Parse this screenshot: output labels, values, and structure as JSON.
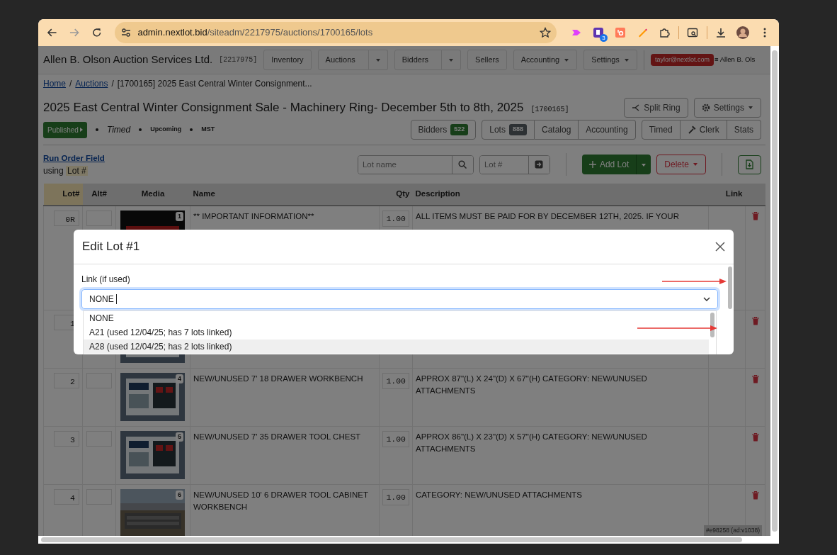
{
  "browser": {
    "url_domain": "admin.nextlot.bid",
    "url_path": "/siteadm/2217975/auctions/1700165/lots",
    "extension_badge": "3"
  },
  "navbar": {
    "brand": "Allen B. Olson Auction Services Ltd.",
    "account_id": "[2217975]",
    "items": [
      {
        "label": "Inventory",
        "kind": "button"
      },
      {
        "label": "Auctions",
        "kind": "split"
      },
      {
        "label": "Bidders",
        "kind": "split"
      },
      {
        "label": "Sellers",
        "kind": "button"
      },
      {
        "label": "Accounting",
        "kind": "dropdown"
      },
      {
        "label": "Settings",
        "kind": "dropdown"
      }
    ],
    "user_badge": "taylor@nextlot.com",
    "user_name": "≡ Allen B. Ols"
  },
  "breadcrumb": [
    {
      "label": "Home",
      "kind": "link"
    },
    {
      "label": "/",
      "kind": "separator"
    },
    {
      "label": "Auctions",
      "kind": "link"
    },
    {
      "label": "/",
      "kind": "separator"
    },
    {
      "label": "[1700165] 2025 East Central Winter Consignment...",
      "kind": "current"
    }
  ],
  "auction": {
    "title": "2025 East Central Winter Consignment Sale - Machinery Ring- December 5th to 8th, 2025",
    "id": "[1700165]",
    "status": "Published",
    "tags": [
      {
        "label": "Timed",
        "kind": "mode"
      },
      {
        "label": "Upcoming",
        "kind": "info"
      },
      {
        "label": "MST",
        "kind": "info"
      }
    ],
    "actions": [
      {
        "label": "Split Ring",
        "kind": "split"
      },
      {
        "label": "Settings",
        "kind": "settings"
      }
    ],
    "tab_groups": [
      [
        {
          "label": "Bidders",
          "count": {
            "label": "522",
            "kind": "success"
          }
        }
      ],
      [
        {
          "label": "Lots",
          "count": {
            "label": "888",
            "kind": "secondary"
          }
        },
        {
          "label": "Catalog"
        },
        {
          "label": "Accounting"
        }
      ],
      [
        {
          "label": "Timed"
        },
        {
          "label": "Clerk",
          "kind": "clerk"
        },
        {
          "label": "Stats"
        }
      ]
    ]
  },
  "toolbar": {
    "sort_link": "Run Order Field",
    "sort_prefix": "using",
    "sort_field": "Lot #",
    "search_placeholder": "Lot name",
    "lot_placeholder": "Lot #",
    "add_button": "Add Lot",
    "delete_button": "Delete"
  },
  "table": {
    "columns": [
      {
        "label": "Lot#",
        "highlighted": true
      },
      {
        "label": "Alt#",
        "highlighted": false
      },
      {
        "label": "Media",
        "highlighted": false
      },
      {
        "label": "Name",
        "highlighted": false
      },
      {
        "label": "Qty",
        "highlighted": false
      },
      {
        "label": "Description",
        "highlighted": false
      },
      {
        "label": "Link",
        "highlighted": false
      }
    ],
    "rows": [
      {
        "lot": "0R",
        "image_number": "1",
        "name": "** IMPORTANT INFORMATION**",
        "qty": "1.00",
        "description": "ALL ITEMS MUST BE PAID FOR BY DECEMBER 12TH, 2025. IF YOUR"
      },
      {
        "lot": "1"
      },
      {
        "lot": "2",
        "image_number": "4",
        "name": "NEW/UNUSED 7' 18 DRAWER WORKBENCH",
        "qty": "1.00",
        "description": "APPROX 87\"(L) X 24\"(D) X 67\"(H) CATEGORY: NEW/UNUSED ATTACHMENTS"
      },
      {
        "lot": "3",
        "image_number": "5",
        "name": "NEW/UNUSED 7' 35 DRAWER TOOL CHEST",
        "qty": "1.00",
        "description": "APPROX 86\"(L) X 23\"(D) X 57\"(H) CATEGORY: NEW/UNUSED ATTACHMENTS"
      },
      {
        "lot": "4",
        "image_number": "6",
        "name": "NEW/UNUSED 10' 6 DRAWER TOOL CABINET WORKBENCH",
        "qty": "1.00",
        "description": "CATEGORY: NEW/UNUSED ATTACHMENTS"
      }
    ]
  },
  "modal": {
    "title": "Edit Lot #1",
    "field_label": "Link (if used)",
    "value": "NONE",
    "options": [
      {
        "label": "NONE",
        "highlighted": false
      },
      {
        "label": "A21 (used 12/04/25; has 7 lots linked)",
        "highlighted": false
      },
      {
        "label": "A28 (used 12/04/25; has 2 lots linked)",
        "highlighted": true
      }
    ]
  },
  "version_badge": "#e98258 (ad:v1038)"
}
